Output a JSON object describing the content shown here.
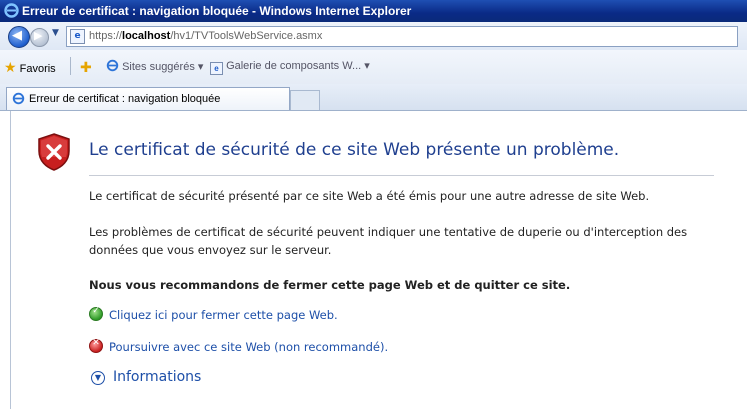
{
  "window": {
    "title": "Erreur de certificat : navigation bloquée - Windows Internet Explorer"
  },
  "address_bar": {
    "url_prefix": "https://",
    "url_host": "localhost",
    "url_path": "/hv1/TVToolsWebService.asmx"
  },
  "favorites_bar": {
    "favorites_label": "Favoris",
    "items": [
      {
        "label": "Sites suggérés ▾",
        "icon": "ie-icon"
      },
      {
        "label": "Galerie de composants W... ▾",
        "icon": "page-icon"
      }
    ]
  },
  "tabs": [
    {
      "label": "Erreur de certificat : navigation bloquée"
    }
  ],
  "page": {
    "heading": "Le certificat de sécurité de ce site Web présente un problème.",
    "paragraph1": "Le certificat de sécurité présenté par ce site Web a été émis pour une autre adresse de site Web.",
    "paragraph2": "Les problèmes de certificat de sécurité peuvent indiquer une tentative de duperie ou d'interception des données que vous envoyez sur le serveur.",
    "recommendation": "Nous vous recommandons de fermer cette page Web et de quitter ce site.",
    "close_link": "Cliquez ici pour fermer cette page Web.",
    "continue_link": "Poursuivre avec ce site Web (non recommandé).",
    "info_link": "Informations"
  },
  "colors": {
    "titlebar": "#0a2a86",
    "link": "#1d4fa8",
    "heading": "#1f3f8f",
    "shield": "#c81f1f"
  }
}
